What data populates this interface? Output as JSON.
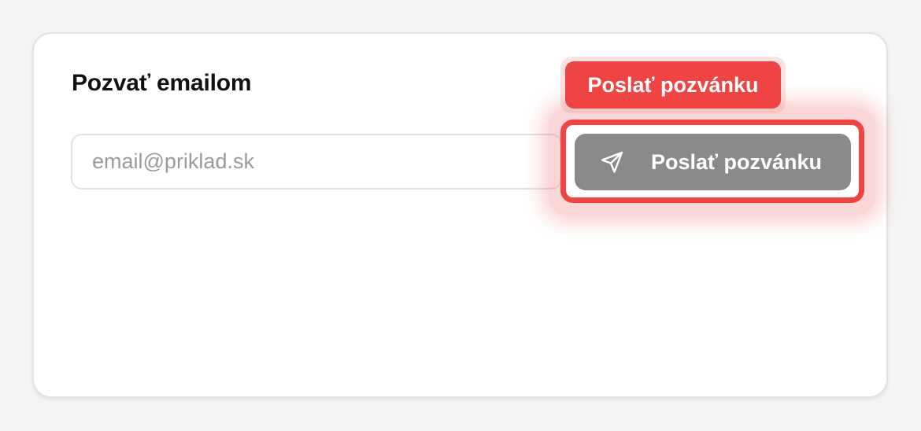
{
  "invite_card": {
    "title": "Pozvať emailom",
    "email_input": {
      "value": "",
      "placeholder": "email@priklad.sk"
    },
    "send_button": {
      "label": "Poslať pozvánku",
      "icon": "send-icon"
    }
  },
  "tooltip": {
    "label": "Poslať pozvánku"
  },
  "colors": {
    "highlight": "#ef4444",
    "button_disabled": "#8a8a8a",
    "card_background": "#ffffff"
  }
}
